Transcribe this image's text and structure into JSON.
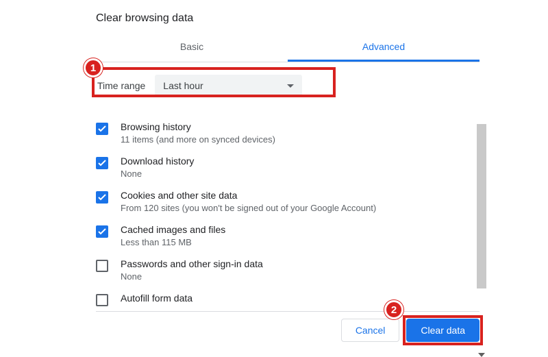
{
  "title": "Clear browsing data",
  "tabs": {
    "basic": "Basic",
    "advanced": "Advanced"
  },
  "time_range": {
    "label": "Time range",
    "value": "Last hour"
  },
  "items": [
    {
      "checked": true,
      "title": "Browsing history",
      "subtitle": "11 items (and more on synced devices)"
    },
    {
      "checked": true,
      "title": "Download history",
      "subtitle": "None"
    },
    {
      "checked": true,
      "title": "Cookies and other site data",
      "subtitle": "From 120 sites (you won't be signed out of your Google Account)"
    },
    {
      "checked": true,
      "title": "Cached images and files",
      "subtitle": "Less than 115 MB"
    },
    {
      "checked": false,
      "title": "Passwords and other sign-in data",
      "subtitle": "None"
    },
    {
      "checked": false,
      "title": "Autofill form data",
      "subtitle": ""
    }
  ],
  "buttons": {
    "cancel": "Cancel",
    "clear": "Clear data"
  },
  "annotations": {
    "step1": "1",
    "step2": "2"
  }
}
